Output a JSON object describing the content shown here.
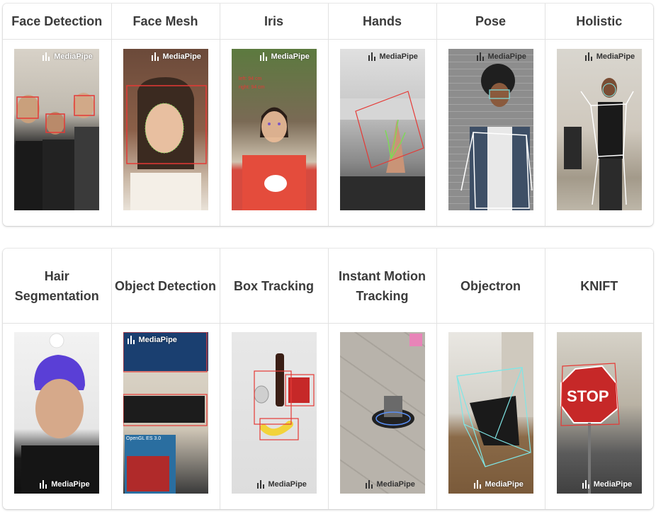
{
  "watermark": "MediaPipe",
  "rows": [
    {
      "solutions": [
        {
          "title": "Face Detection",
          "icon": "face-detection-image"
        },
        {
          "title": "Face Mesh",
          "icon": "face-mesh-image"
        },
        {
          "title": "Iris",
          "icon": "iris-image"
        },
        {
          "title": "Hands",
          "icon": "hands-image"
        },
        {
          "title": "Pose",
          "icon": "pose-image"
        },
        {
          "title": "Holistic",
          "icon": "holistic-image"
        }
      ]
    },
    {
      "solutions": [
        {
          "title": "Hair Segmentation",
          "icon": "hair-segmentation-image"
        },
        {
          "title": "Object Detection",
          "icon": "object-detection-image"
        },
        {
          "title": "Box Tracking",
          "icon": "box-tracking-image"
        },
        {
          "title": "Instant Motion Tracking",
          "icon": "instant-motion-tracking-image"
        },
        {
          "title": "Objectron",
          "icon": "objectron-image"
        },
        {
          "title": "KNIFT",
          "icon": "knift-image"
        }
      ]
    }
  ],
  "colors": {
    "detection_red": "#e53935",
    "mesh_green": "#7ed957",
    "pose_white": "#ffffff",
    "box_cyan": "#7fe6e6"
  }
}
